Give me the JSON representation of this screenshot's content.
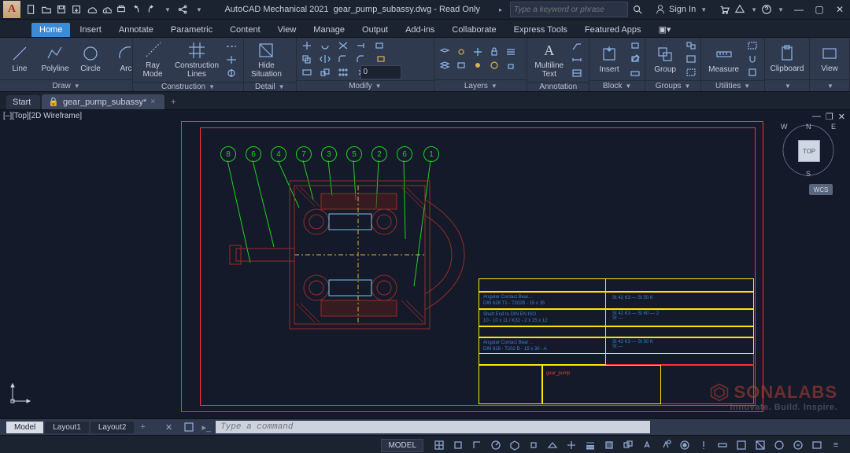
{
  "app": {
    "name": "AutoCAD Mechanical 2021",
    "file": "gear_pump_subassy.dwg",
    "mode": "Read Only",
    "logo_letter": "A"
  },
  "header_search_placeholder": "Type a keyword or phrase",
  "signin_label": "Sign In",
  "ribbon_tabs": [
    "Home",
    "Insert",
    "Annotate",
    "Parametric",
    "Content",
    "View",
    "Manage",
    "Output",
    "Add-ins",
    "Collaborate",
    "Express Tools",
    "Featured Apps"
  ],
  "ribbon_active_tab": "Home",
  "panels": {
    "draw": {
      "title": "Draw",
      "line": "Line",
      "polyline": "Polyline",
      "circle": "Circle",
      "arc": "Arc"
    },
    "construction": {
      "title": "Construction",
      "ray": "Ray\nMode",
      "clines": "Construction\nLines"
    },
    "detail": {
      "title": "Detail",
      "hide": "Hide\nSituation"
    },
    "modify": {
      "title": "Modify",
      "num_value": "0"
    },
    "layers": {
      "title": "Layers"
    },
    "annotation": {
      "title": "Annotation",
      "mtext": "Multiline\nText"
    },
    "block": {
      "title": "Block",
      "insert": "Insert"
    },
    "groups": {
      "title": "Groups",
      "group": "Group"
    },
    "utilities": {
      "title": "Utilities",
      "measure": "Measure"
    },
    "clipboard": {
      "title": "Clipboard"
    },
    "view": {
      "title": "View"
    }
  },
  "file_tabs": {
    "start": "Start",
    "active": "gear_pump_subassy*"
  },
  "viewport_label": "[–][Top][2D Wireframe]",
  "balloons": [
    "8",
    "6",
    "4",
    "7",
    "3",
    "5",
    "2",
    "6",
    "1"
  ],
  "navcube": {
    "face": "TOP",
    "n": "N",
    "s": "S",
    "e": "E",
    "w": "W",
    "wcs": "WCS"
  },
  "watermark": {
    "brand": "SONALABS",
    "tagline": "Innovate. Build. Inspire."
  },
  "model_tabs": [
    "Model",
    "Layout1",
    "Layout2"
  ],
  "model_active": "Model",
  "command_placeholder": "Type a command",
  "status_model": "MODEL"
}
